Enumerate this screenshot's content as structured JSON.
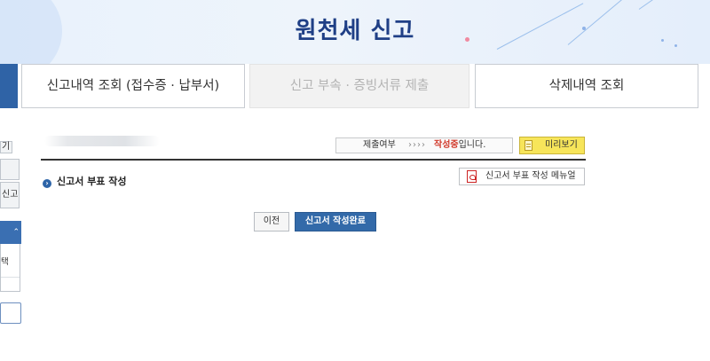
{
  "header": {
    "title": "원천세 신고"
  },
  "tabs": [
    {
      "label": "신고내역 조회 (접수증 · 납부서)",
      "state": "enabled"
    },
    {
      "label": "신고 부속 · 증빙서류 제출",
      "state": "disabled"
    },
    {
      "label": "삭제내역 조회",
      "state": "enabled"
    }
  ],
  "left_sidebar": {
    "button1_partial": "기",
    "button3_partial": "신고",
    "panel_item_partial": "택"
  },
  "status": {
    "label": "제출여부",
    "arrows": "››››",
    "state_highlight": "작성중",
    "state_suffix": "입니다.",
    "preview_label": "미리보기"
  },
  "section": {
    "bullet": "›",
    "title": "신고서 부표 작성",
    "manual_label": "신고서 부표 작성 메뉴얼"
  },
  "actions": {
    "prev_label": "이전",
    "complete_label": "신고서 작성완료"
  },
  "colors": {
    "brand": "#1f3f86",
    "primary_button": "#336aa9",
    "highlight": "#d13a2b",
    "preview_button": "#f7e55a"
  },
  "icons": [
    "document-icon",
    "pdf-icon",
    "bullet-arrow-icon",
    "chevron-up-icon"
  ]
}
